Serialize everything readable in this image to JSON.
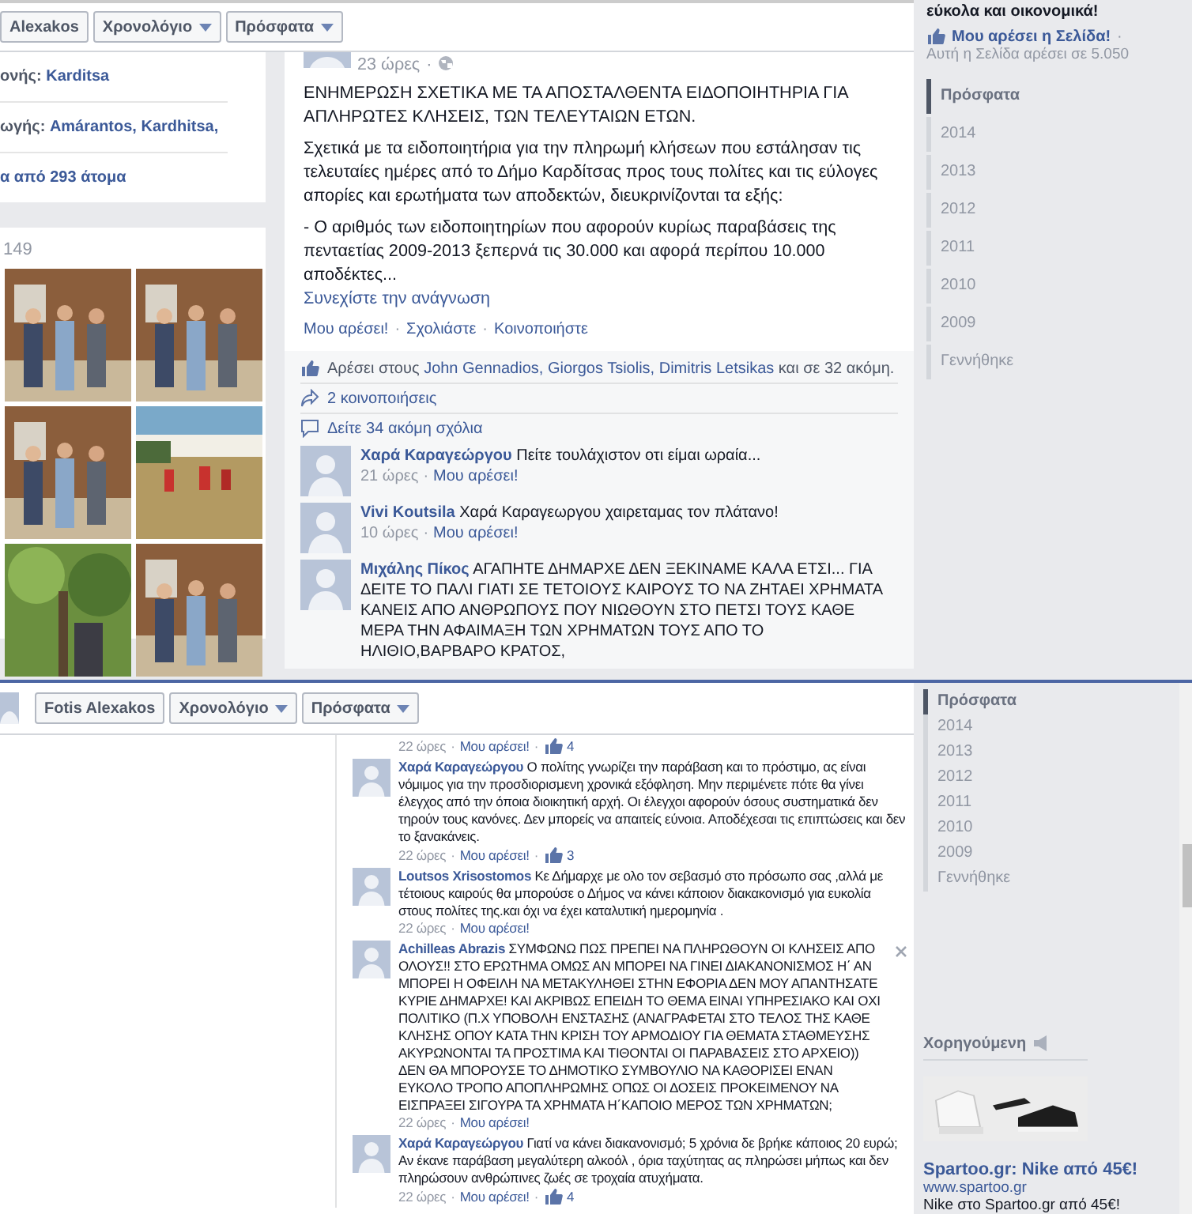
{
  "sep": "·",
  "top": {
    "header": {
      "name": "Alexakos",
      "menus": [
        "Χρονολόγιο",
        "Πρόσφατα"
      ]
    },
    "about": [
      {
        "label": "ονής:",
        "value": "Karditsa"
      },
      {
        "label": "ωγής:",
        "value": "Amárantos, Kardhitsa,"
      },
      {
        "value": "α από 293 άτομα"
      }
    ],
    "photos": {
      "count": "149"
    },
    "post": {
      "time": "23 ώρες",
      "title": "ΕΝΗΜΕΡΩΣΗ ΣΧΕΤΙΚΑ ΜΕ ΤΑ ΑΠΟΣΤΑΛΘΕΝΤΑ ΕΙΔΟΠΟΙΗΤΗΡΙΑ ΓΙΑ ΑΠΛΗΡΩΤΕΣ ΚΛΗΣΕΙΣ, ΤΩΝ ΤΕΛΕΥΤΑΙΩΝ ΕΤΩΝ.",
      "paragraph": "Σχετικά με τα ειδοποιητήρια για την πληρωμή κλήσεων που εστάλησαν τις τελευταίες ημέρες από το Δήμο Καρδίτσας προς τους πολίτες και τις εύλογες απορίες και ερωτήματα των αποδεκτών, διευκρινίζονται τα εξής:",
      "bullet": "- Ο αριθμός των ειδοποιητηρίων που αφορούν κυρίως παραβάσεις της πενταετίας 2009-2013 ξεπερνά τις 30.000 και αφορά περίπου 10.000 αποδέκτες...",
      "more": "Συνεχίστε την ανάγνωση",
      "actions": [
        "Μου αρέσει!",
        "Σχολιάστε",
        "Κοινοποιήστε"
      ],
      "likes": {
        "prefix": "Αρέσει στους",
        "names": "John Gennadios, Giorgos Tsiolis, Dimitris Letsikas",
        "suffix": "και σε 32 ακόμη."
      },
      "shares": "2 κοινοποιήσεις",
      "more_comments": "Δείτε 34 ακόμη σχόλια",
      "comments": [
        {
          "author": "Χαρά Καραγεώργου",
          "text": "Πείτε τουλάχιστον οτι είμαι ωραία...",
          "time": "21 ώρες",
          "like": "Μου αρέσει!"
        },
        {
          "author": "Vivi Koutsila",
          "text": "Χαρά Καραγεωργου χαιρεταμας τον πλάτανο!",
          "time": "10 ώρες",
          "like": "Μου αρέσει!"
        },
        {
          "author": "Μιχάλης Πίκος",
          "text": "ΑΓΑΠΗΤΕ ΔΗΜΑΡΧΕ ΔΕΝ ΞΕΚΙΝΑΜΕ ΚΑΛΑ ΕΤΣΙ... ΓΙΑ ΔΕΙΤΕ ΤΟ ΠΑΛΙ ΓΙΑΤΙ ΣΕ ΤΕΤΟΙΟΥΣ ΚΑΙΡΟΥΣ ΤΟ ΝΑ ΖΗΤΑΕΙ ΧΡΗΜΑΤΑ ΚΑΝΕΙΣ ΑΠΟ ΑΝΘΡΩΠΟΥΣ ΠΟΥ ΝΙΩΘΟΥΝ ΣΤΟ ΠΕΤΣΙ ΤΟΥΣ ΚΑΘΕ ΜΕΡΑ ΤΗΝ ΑΦΑΙΜΑΞΗ ΤΩΝ ΧΡΗΜΑΤΩΝ ΤΟΥΣ ΑΠΟ ΤΟ ΗΛΙΘΙΟ,ΒΑΡΒΑΡΟ ΚΡΑΤΟΣ,"
        }
      ]
    },
    "sidebar": {
      "promo": "εύκολα και οικονομικά!",
      "like_page": "Μου αρέσει η Σελίδα!",
      "page_likes": "Αυτή η Σελίδα αρέσει σε 5.050",
      "timeline": [
        {
          "label": "Πρόσφατα",
          "selected": true
        },
        {
          "label": "2014",
          "selected": false
        },
        {
          "label": "2013",
          "selected": false
        },
        {
          "label": "2012",
          "selected": false
        },
        {
          "label": "2011",
          "selected": false
        },
        {
          "label": "2010",
          "selected": false
        },
        {
          "label": "2009",
          "selected": false
        },
        {
          "label": "Γεννήθηκε",
          "selected": false
        }
      ]
    }
  },
  "bottom": {
    "header": {
      "name": "Fotis Alexakos",
      "menus": [
        "Χρονολόγιο",
        "Πρόσφατα"
      ]
    },
    "comments": [
      {
        "time": "22 ώρες",
        "like": "Μου αρέσει!",
        "likes": "4"
      },
      {
        "author": "Χαρά Καραγεώργου",
        "text": "Ο πολίτης γνωρίζει την παράβαση και το πρόστιμο, ας είναι νόμιμος για την προσδιορισμενη χρονικά εξόφληση. Μην περιμένετε πότε θα γίνει έλεγχος από την όποια διοικητική αρχή. Οι έλεγχοι αφορούν όσους συστηματικά δεν τηρούν τους κανόνες. Δεν μπορείς να απαιτείς εύνοια. Αποδέχεσαι τις επιπτώσεις και δεν το ξανακάνεις.",
        "time": "22 ώρες",
        "like": "Μου αρέσει!",
        "likes": "3"
      },
      {
        "author": "Loutsos Xrisostomos",
        "text": "Κε Δήμαρχε με ολο τον σεβασμό στο πρόσωπο σας ,αλλά με τέτοιους καιρούς θα μπορούσε ο Δήμος να κάνει κάποιον διακακονισμό για ευκολία στους πολίτες της.και όχι να έχει καταλυτική ημερομηνία .",
        "time": "22 ώρες",
        "like": "Μου αρέσει!"
      },
      {
        "author": "Achilleas Abrazis",
        "text": "ΣΥΜΦΩΝΩ ΠΩΣ ΠΡΕΠΕΙ ΝΑ ΠΛΗΡΩΘΟΥΝ ΟΙ ΚΛΗΣΕΙΣ ΑΠΟ ΟΛΟΥΣ!! ΣΤΟ ΕΡΩΤΗΜΑ ΟΜΩΣ ΑΝ ΜΠΟΡΕΙ ΝΑ ΓΙΝΕΙ ΔΙΑΚΑΝΟΝΙΣΜΟΣ Η΄ ΑΝ ΜΠΟΡΕΙ Η ΟΦΕΙΛΗ ΝΑ ΜΕΤΑΚΥΛΗΘΕΙ ΣΤΗΝ ΕΦΟΡΙΑ ΔΕΝ ΜΟΥ ΑΠΑΝΤΗΣΑΤΕ ΚΥΡΙΕ ΔΗΜΑΡΧΕ! ΚΑΙ ΑΚΡΙΒΩΣ ΕΠΕΙΔΗ ΤΟ ΘΕΜΑ ΕΙΝΑΙ ΥΠΗΡΕΣΙΑΚΟ ΚΑΙ ΟΧΙ ΠΟΛΙΤΙΚΟ (Π.Χ ΥΠΟΒΟΛΗ ΕΝΣΤΑΣΗΣ (ΑΝΑΓΡΑΦΕΤΑΙ ΣΤΟ ΤΕΛΟΣ ΤΗΣ ΚΑΘΕ ΚΛΗΣΗΣ ΟΠΟΥ ΚΑΤΑ ΤΗΝ ΚΡΙΣΗ ΤΟΥ ΑΡΜΟΔΙΟΥ ΓΙΑ ΘΕΜΑΤΑ ΣΤΑΘΜΕΥΣΗΣ ΑΚΥΡΩΝΟΝΤΑΙ ΤΑ ΠΡΟΣΤΙΜΑ ΚΑΙ ΤΙΘΟΝΤΑΙ ΟΙ ΠΑΡΑΒΑΣΕΙΣ ΣΤΟ ΑΡΧΕΙΟ)) ΔΕΝ ΘΑ ΜΠΟΡΟΥΣΕ ΤΟ ΔΗΜΟΤΙΚΟ ΣΥΜΒΟΥΛΙΟ ΝΑ ΚΑΘΟΡΙΣΕΙ ΕΝΑΝ ΕΥΚΟΛΟ ΤΡΟΠΟ ΑΠΟΠΛΗΡΩΜΗΣ ΟΠΩΣ ΟΙ ΔΟΣΕΙΣ ΠΡΟΚΕΙΜΕΝΟΥ ΝΑ ΕΙΣΠΡΑΞΕΙ ΣΙΓΟΥΡΑ ΤΑ ΧΡΗΜΑΤΑ Η΄ΚΑΠΟΙΟ ΜΕΡΟΣ ΤΩΝ ΧΡΗΜΑΤΩΝ;",
        "time": "22 ώρες",
        "like": "Μου αρέσει!",
        "closable": true
      },
      {
        "author": "Χαρά Καραγεώργου",
        "text": "Γιατί να κάνει διακανονισμό; 5 χρόνια δε βρήκε κάποιος 20 ευρώ; Αν έκανε παράβαση μεγαλύτερη αλκοόλ , όρια ταχύτητας ας πληρώσει μήπως και δεν πληρώσουν ανθρώπινες ζωές σε τροχαία ατυχήματα.",
        "time": "22 ώρες",
        "like": "Μου αρέσει!",
        "likes": "4"
      }
    ],
    "sidebar": {
      "timeline": [
        {
          "label": "Πρόσφατα",
          "selected": true
        },
        {
          "label": "2014",
          "selected": false
        },
        {
          "label": "2013",
          "selected": false
        },
        {
          "label": "2012",
          "selected": false
        },
        {
          "label": "2011",
          "selected": false
        },
        {
          "label": "2010",
          "selected": false
        },
        {
          "label": "2009",
          "selected": false
        },
        {
          "label": "Γεννήθηκε",
          "selected": false
        }
      ],
      "sponsored": "Χορηγούμενη",
      "ad": {
        "kind": "picture",
        "title": "Spartoo.gr: Nike από 45€!",
        "url": "www.spartoo.gr",
        "text": "Nike στο Spartoo.gr από 45€!"
      }
    }
  }
}
